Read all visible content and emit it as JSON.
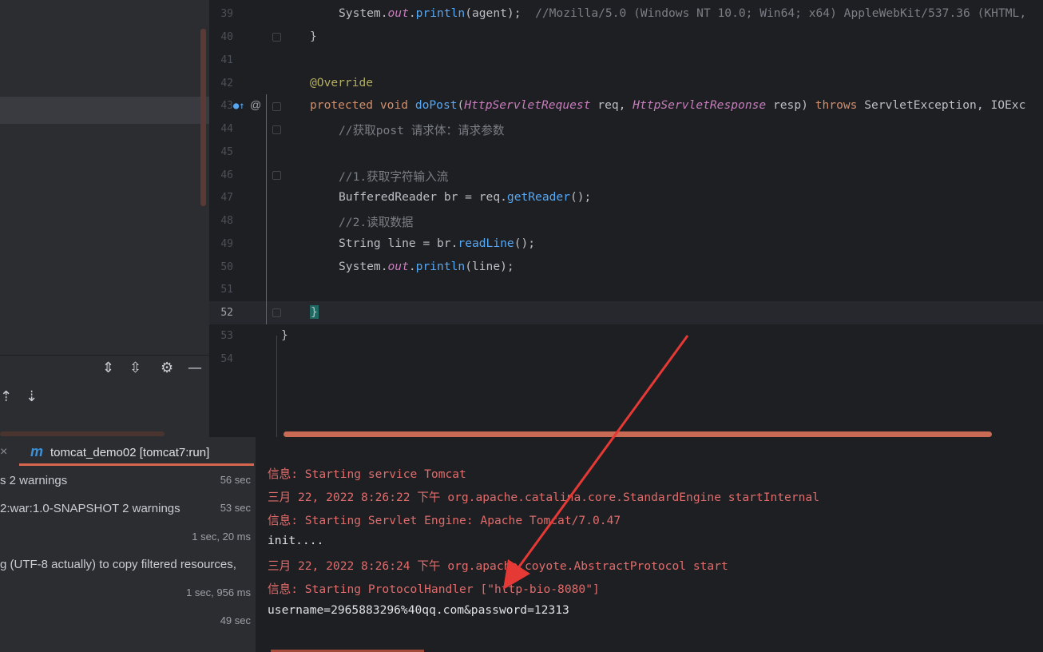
{
  "editor": {
    "line_numbers": [
      "39",
      "40",
      "41",
      "42",
      "43",
      "44",
      "45",
      "46",
      "47",
      "48",
      "49",
      "50",
      "51",
      "52",
      "53",
      "54"
    ],
    "current_line": "52",
    "lines": {
      "l39": {
        "obj": "System",
        "dot": ".",
        "field": "out",
        "dot2": ".",
        "call": "println",
        "open": "(",
        "arg": "agent",
        "close": ");",
        "comment": "  //Mozilla/5.0 (Windows NT 10.0; Win64; x64) AppleWebKit/537.36 (KHTML,"
      },
      "l40": "}",
      "l42": "@Override",
      "l43": {
        "kw1": "protected",
        "kw2": "void",
        "name": "doPost",
        "open": "(",
        "t1": "HttpServletRequest",
        "p1": "req",
        "comma": ",",
        "t2": "HttpServletResponse",
        "p2": "resp",
        "close": ")",
        "throws": "throws",
        "ex1": "ServletException",
        "comma2": ",",
        "ex2": "IOExc"
      },
      "l44": "//获取post 请求体：请求参数",
      "l46": "//1.获取字符输入流",
      "l47": {
        "type": "BufferedReader",
        "var": "br",
        "eq": " = ",
        "obj": "req",
        "dot": ".",
        "call": "getReader",
        "end": "();"
      },
      "l48": "//2.读取数据",
      "l49": {
        "type": "String",
        "var": "line",
        "eq": " = ",
        "obj": "br",
        "dot": ".",
        "call": "readLine",
        "end": "();"
      },
      "l50": {
        "obj": "System",
        "dot": ".",
        "field": "out",
        "dot2": ".",
        "call": "println",
        "open": "(",
        "arg": "line",
        "close": ");"
      },
      "l52": "}",
      "l53": "}"
    },
    "gutter_icons": [
      "override-icon",
      "at-icon"
    ],
    "at_symbol": "@"
  },
  "run_panel": {
    "tab_label": "tomcat_demo02 [tomcat7:run]",
    "tab_icon": "m",
    "close_glyph": "×",
    "rows": [
      {
        "text": "s  2 warnings",
        "time": "56 sec"
      },
      {
        "text": "2:war:1.0-SNAPSHOT  2 warnings",
        "time": "53 sec"
      },
      {
        "text": "",
        "time": "1 sec, 20 ms"
      },
      {
        "text": "g (UTF-8 actually) to copy filtered resources,",
        "time": ""
      },
      {
        "text": "",
        "time": "1 sec, 956 ms"
      },
      {
        "text": "",
        "time": "49 sec"
      }
    ]
  },
  "console": {
    "lines": [
      "信息: Starting service Tomcat",
      "三月 22, 2022 8:26:22 下午 org.apache.catalina.core.StandardEngine startInternal",
      "信息: Starting Servlet Engine: Apache Tomcat/7.0.47",
      "init....",
      "三月 22, 2022 8:26:24 下午 org.apache.coyote.AbstractProtocol start",
      "信息: Starting ProtocolHandler [\"http-bio-8080\"]",
      "username=2965883296%40qq.com&password=12313"
    ]
  },
  "colors": {
    "accent_red": "#e06c6c",
    "arrow": "#e53935",
    "scroll_thumb": "#c96a55"
  }
}
